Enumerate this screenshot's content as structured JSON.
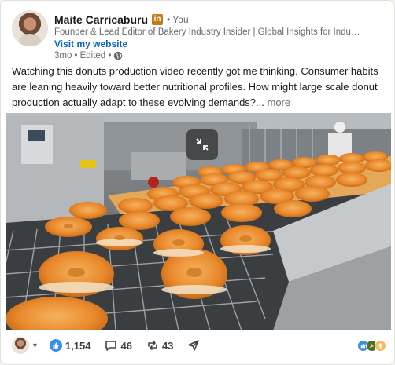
{
  "post": {
    "author": {
      "name": "Maite Carricaburu",
      "badge": "in",
      "degree": "• You",
      "headline": "Founder & Lead Editor of Bakery Industry Insider | Global Insights for Industrial ...",
      "website_link": "Visit my website"
    },
    "meta": {
      "time": "3mo",
      "edited": "• Edited •",
      "visibility_icon": "globe-icon"
    },
    "text": "Watching this donuts production video recently got me thinking. Consumer habits are leaning heavily toward better nutritional profiles. How might large scale donut production actually adapt to these evolving demands?...",
    "more_label": "more",
    "media": {
      "type": "video",
      "fullscreen_icon": "minimize-icon"
    }
  },
  "footer": {
    "reactions_count": "1,154",
    "comments_count": "46",
    "reposts_count": "43",
    "reaction_icons": [
      "like-icon",
      "celebrate-icon",
      "insightful-icon"
    ]
  },
  "colors": {
    "link_blue": "#0a66c2",
    "badge_gold": "#c37d16",
    "like_blue": "#378fe9"
  }
}
